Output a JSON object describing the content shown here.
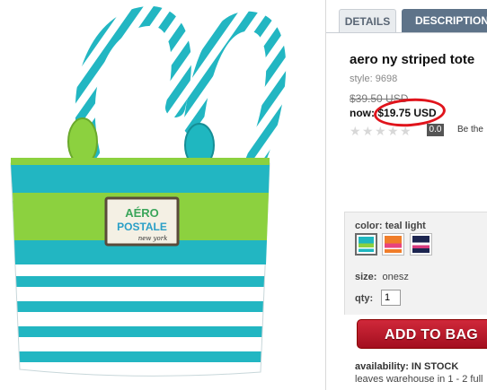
{
  "tabs": [
    {
      "label": "DETAILS",
      "active": true
    },
    {
      "label": "DESCRIPTION",
      "active": false
    }
  ],
  "product": {
    "title": "aero ny striped tote",
    "style": "style: 9698",
    "original_price": "$39.50 USD",
    "now_label": "now:",
    "sale_price": "$19.75 USD",
    "rating_score": "0.0",
    "rating_prompt": "Be the",
    "logo_text_top": "AÉRO",
    "logo_text_bottom": "POSTALE",
    "logo_script": "new york"
  },
  "options": {
    "color_label": "color: teal light",
    "swatches": [
      {
        "name": "teal light",
        "colors": [
          "#1fb7c0",
          "#8cd13f"
        ],
        "selected": true
      },
      {
        "name": "orange",
        "colors": [
          "#f07d2a",
          "#e8437f"
        ],
        "selected": false
      },
      {
        "name": "navy",
        "colors": [
          "#1c2550",
          "#ffffff",
          "#d63a7c"
        ],
        "selected": false
      }
    ],
    "size_label": "size:",
    "size_value": "onesz",
    "qty_label": "qty:",
    "qty_value": "1"
  },
  "actions": {
    "add_to_bag": "ADD TO BAG"
  },
  "availability": {
    "label": "availability:",
    "status": "IN STOCK",
    "warehouse": "leaves warehouse in 1 - 2 full"
  },
  "colors": {
    "teal": "#1fb7c0",
    "lime": "#8cd13f",
    "accent_red": "#c41e2e",
    "tab_active": "#5e7389"
  }
}
